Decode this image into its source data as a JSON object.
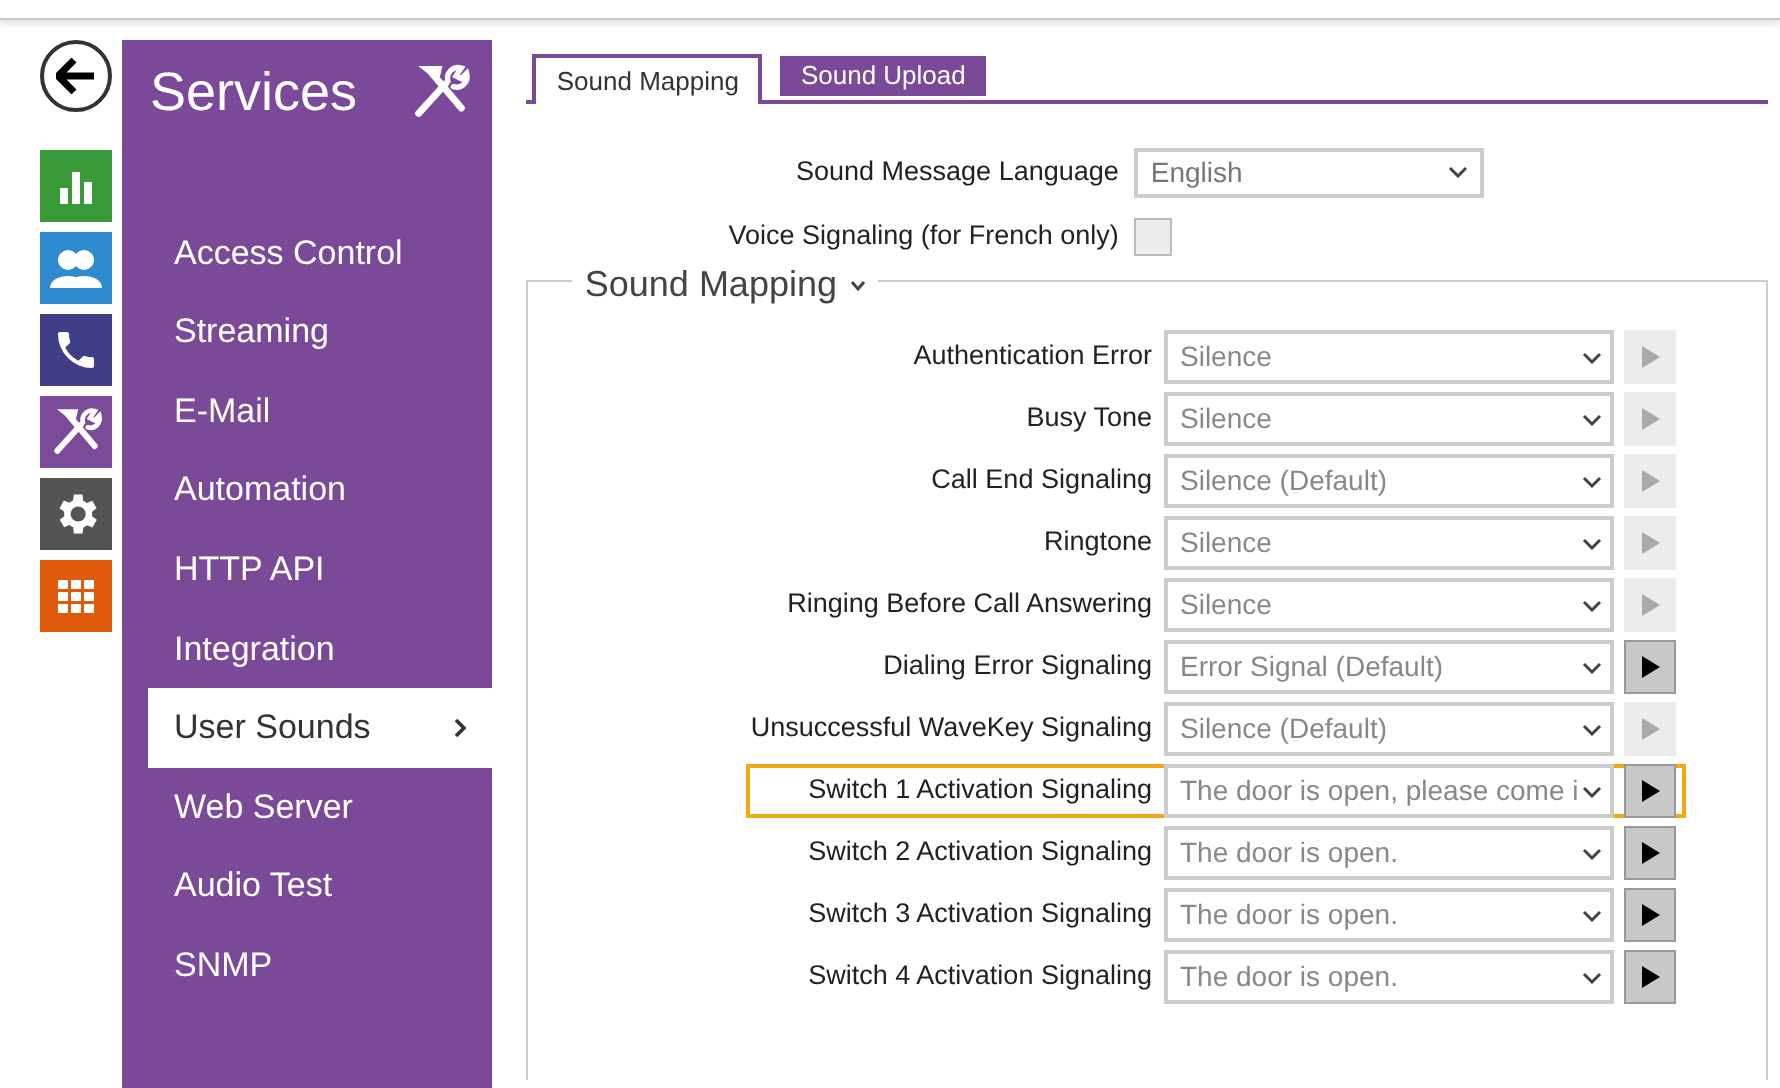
{
  "nav_icons": [
    {
      "kind": "status",
      "color": "#3a9a3a"
    },
    {
      "kind": "directory",
      "color": "#2f8bd0"
    },
    {
      "kind": "phone",
      "color": "#3f3d86"
    },
    {
      "kind": "services",
      "color": "#7b4a98"
    },
    {
      "kind": "system",
      "color": "#545454"
    },
    {
      "kind": "apps",
      "color": "#e05a0c"
    }
  ],
  "sidebar": {
    "title": "Services",
    "items": [
      {
        "label": "Access Control",
        "selected": false
      },
      {
        "label": "Streaming",
        "selected": false
      },
      {
        "label": "E-Mail",
        "selected": false
      },
      {
        "label": "Automation",
        "selected": false
      },
      {
        "label": "HTTP API",
        "selected": false
      },
      {
        "label": "Integration",
        "selected": false
      },
      {
        "label": "User Sounds",
        "selected": true
      },
      {
        "label": "Web Server",
        "selected": false
      },
      {
        "label": "Audio Test",
        "selected": false
      },
      {
        "label": "SNMP",
        "selected": false
      }
    ]
  },
  "tabs": [
    {
      "label": "Sound Mapping",
      "selected": true
    },
    {
      "label": "Sound Upload",
      "selected": false
    }
  ],
  "language": {
    "label": "Sound Message Language",
    "value": "English"
  },
  "voice_signaling": {
    "label": "Voice Signaling (for French only)",
    "checked": false
  },
  "section": {
    "title": "Sound Mapping",
    "expanded": true,
    "rows": [
      {
        "label": "Authentication Error",
        "value": "Silence",
        "play_enabled": false,
        "highlighted": false
      },
      {
        "label": "Busy Tone",
        "value": "Silence",
        "play_enabled": false,
        "highlighted": false
      },
      {
        "label": "Call End Signaling",
        "value": "Silence (Default)",
        "play_enabled": false,
        "highlighted": false
      },
      {
        "label": "Ringtone",
        "value": "Silence",
        "play_enabled": false,
        "highlighted": false
      },
      {
        "label": "Ringing Before Call Answering",
        "value": "Silence",
        "play_enabled": false,
        "highlighted": false
      },
      {
        "label": "Dialing Error Signaling",
        "value": "Error Signal (Default)",
        "play_enabled": true,
        "highlighted": false
      },
      {
        "label": "Unsuccessful WaveKey Signaling",
        "value": "Silence (Default)",
        "play_enabled": false,
        "highlighted": false
      },
      {
        "label": "Switch 1 Activation Signaling",
        "value": "The door is open, please come i",
        "play_enabled": true,
        "highlighted": true
      },
      {
        "label": "Switch 2 Activation Signaling",
        "value": "The door is open.",
        "play_enabled": true,
        "highlighted": false
      },
      {
        "label": "Switch 3 Activation Signaling",
        "value": "The door is open.",
        "play_enabled": true,
        "highlighted": false
      },
      {
        "label": "Switch 4 Activation Signaling",
        "value": "The door is open.",
        "play_enabled": true,
        "highlighted": false
      }
    ]
  }
}
